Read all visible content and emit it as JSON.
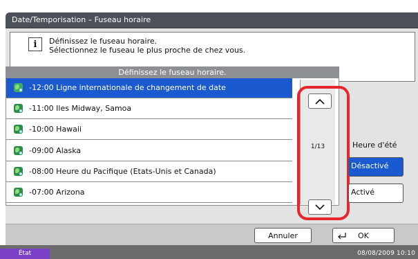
{
  "window": {
    "title": "Date/Temporisation – Fuseau horaire"
  },
  "info": {
    "icon": "info-icon",
    "line1": "Définissez le fuseau horaire.",
    "line2": "Sélectionnez le fuseau le plus proche de chez vous."
  },
  "list": {
    "header": "Définissez le fuseau horaire.",
    "items": [
      {
        "label": "-12:00 Ligne internationale de changement de date",
        "icon": "globe-icon",
        "selected": true
      },
      {
        "label": "-11:00 Iles Midway, Samoa",
        "icon": "globe-icon",
        "selected": false
      },
      {
        "label": "-10:00 Hawaii",
        "icon": "globe-icon",
        "selected": false
      },
      {
        "label": "-09:00 Alaska",
        "icon": "globe-icon",
        "selected": false
      },
      {
        "label": "-08:00 Heure du Pacifique (Etats-Unis et Canada)",
        "icon": "globe-icon",
        "selected": false
      },
      {
        "label": "-07:00 Arizona",
        "icon": "globe-icon",
        "selected": false
      }
    ],
    "page": "1/13",
    "scroll_up_icon": "chevron-up-icon",
    "scroll_down_icon": "chevron-down-icon"
  },
  "dst": {
    "label": "Heure d'été",
    "off": "Désactivé",
    "on": "Activé",
    "selected": "Désactivé"
  },
  "footer": {
    "cancel": "Annuler",
    "ok": "OK",
    "ok_icon": "enter-arrow-icon"
  },
  "status": {
    "state": "État",
    "datetime": "08/08/2009   10:10"
  },
  "colors": {
    "selection": "#1a59ce",
    "titlebar": "#4c5058",
    "highlight_ring": "#e6262a",
    "status_state": "#7a3fc7"
  }
}
